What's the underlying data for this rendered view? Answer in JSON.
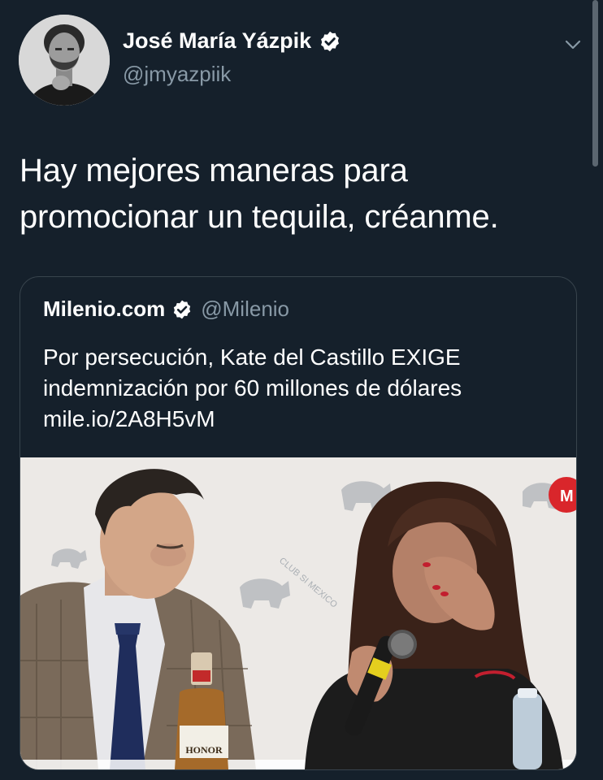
{
  "tweet": {
    "display_name": "José María Yázpik",
    "handle": "@jmyazpiik",
    "text_lines": [
      "Hay mejores maneras para",
      "promocionar un tequila, créanme."
    ],
    "verified": true
  },
  "quoted_tweet": {
    "display_name": "Milenio.com",
    "handle": "@Milenio",
    "verified": true,
    "text_lines": [
      "Por persecución, Kate del Castillo EXIGE",
      "indemnización por 60 millones de dólares",
      "mile.io/2A8H5vM"
    ],
    "photo": {
      "backdrop_text": "CLUB SI MEXICO",
      "bottle_label": "HONOR"
    }
  },
  "colors": {
    "background": "#15202b",
    "text_primary": "#ffffff",
    "text_secondary": "#8899a6",
    "border": "#38444d",
    "verified_badge": "#ffffff"
  },
  "icons": {
    "verified": "verified-badge-icon",
    "more": "chevron-down-icon"
  }
}
